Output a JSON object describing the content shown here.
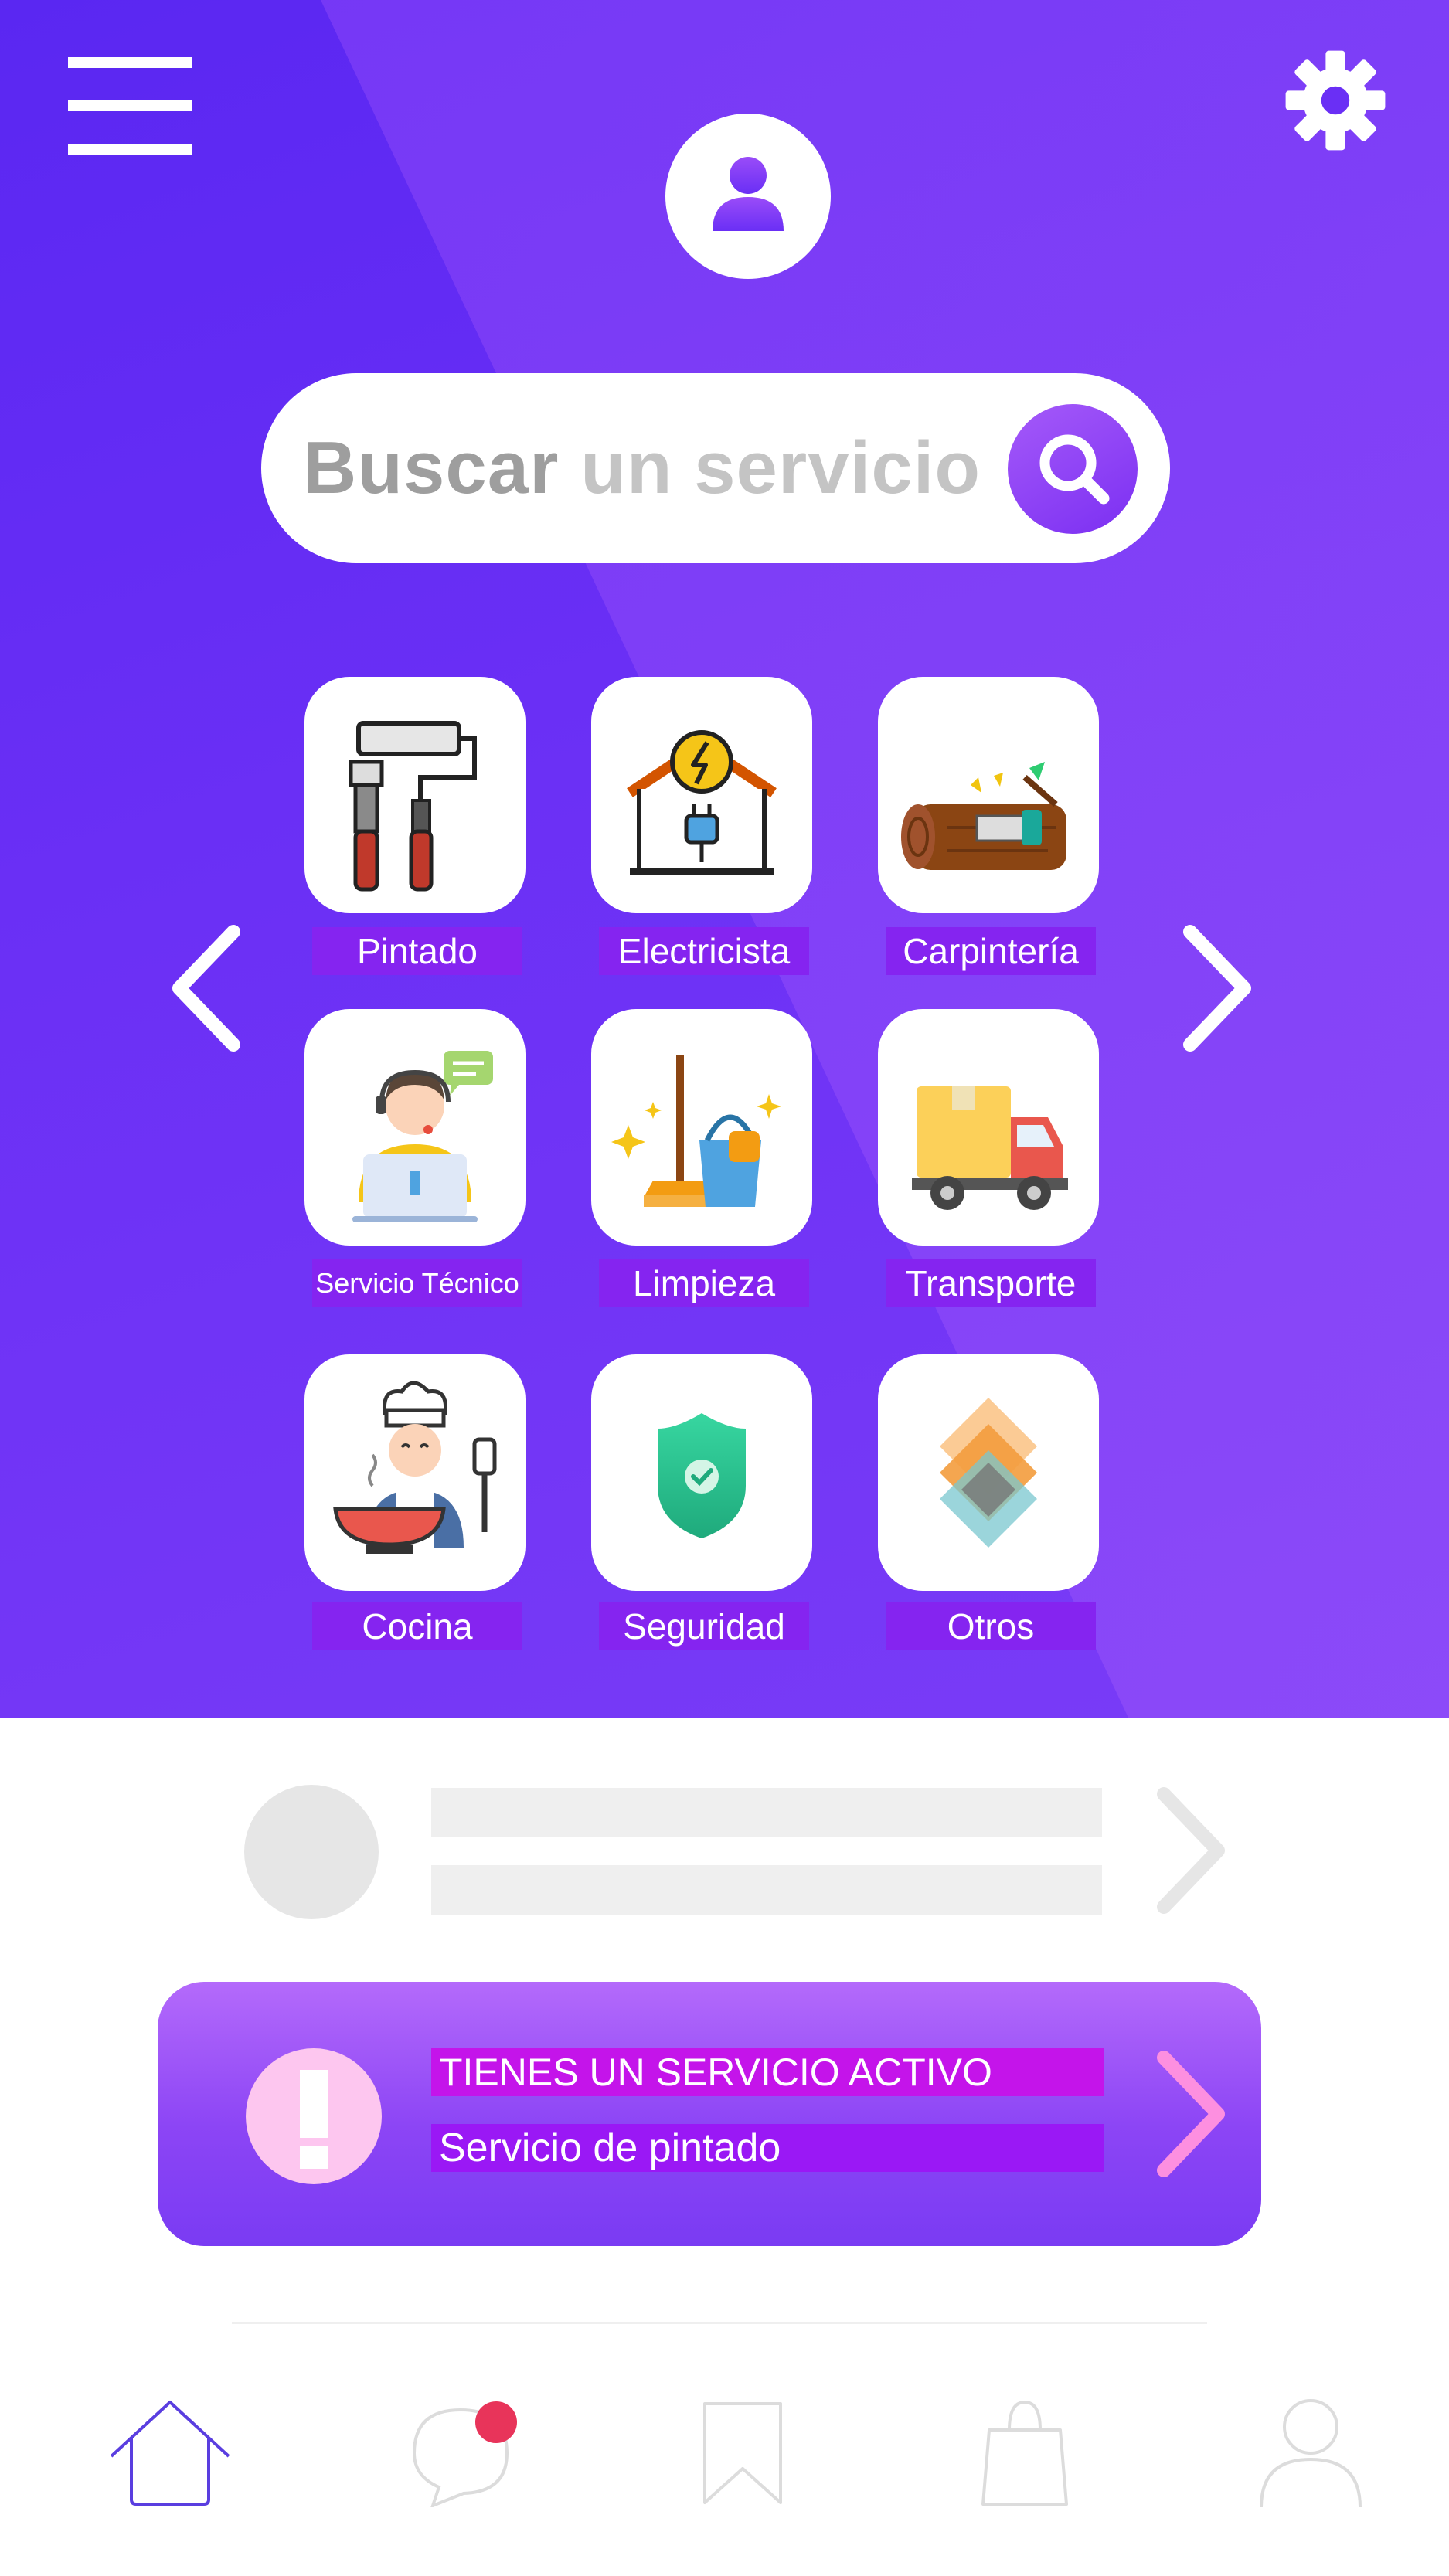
{
  "search": {
    "prefix": "Buscar",
    "rest": " un servicio"
  },
  "services": [
    {
      "label": "Pintado",
      "icon": "paint-roller-icon"
    },
    {
      "label": "Electricista",
      "icon": "electric-house-icon"
    },
    {
      "label": "Carpintería",
      "icon": "saw-log-icon"
    },
    {
      "label": "Servicio Técnico",
      "icon": "technician-icon"
    },
    {
      "label": "Limpieza",
      "icon": "broom-bucket-icon"
    },
    {
      "label": "Transporte",
      "icon": "delivery-truck-icon"
    },
    {
      "label": "Cocina",
      "icon": "chef-icon"
    },
    {
      "label": "Seguridad",
      "icon": "shield-check-icon"
    },
    {
      "label": "Otros",
      "icon": "layers-icon"
    }
  ],
  "active_service": {
    "title": "TIENES UN SERVICIO ACTIVO",
    "name": "Servicio de pintado"
  },
  "bottom_nav": [
    "home-icon",
    "chat-icon",
    "bookmark-icon",
    "shopping-bag-icon",
    "profile-icon"
  ],
  "colors": {
    "hero_start": "#5a27f2",
    "hero_end": "#7a3cf7",
    "label_bg": "#8524f0",
    "active_card": "#9b50f7",
    "badge": "#e8345a"
  }
}
